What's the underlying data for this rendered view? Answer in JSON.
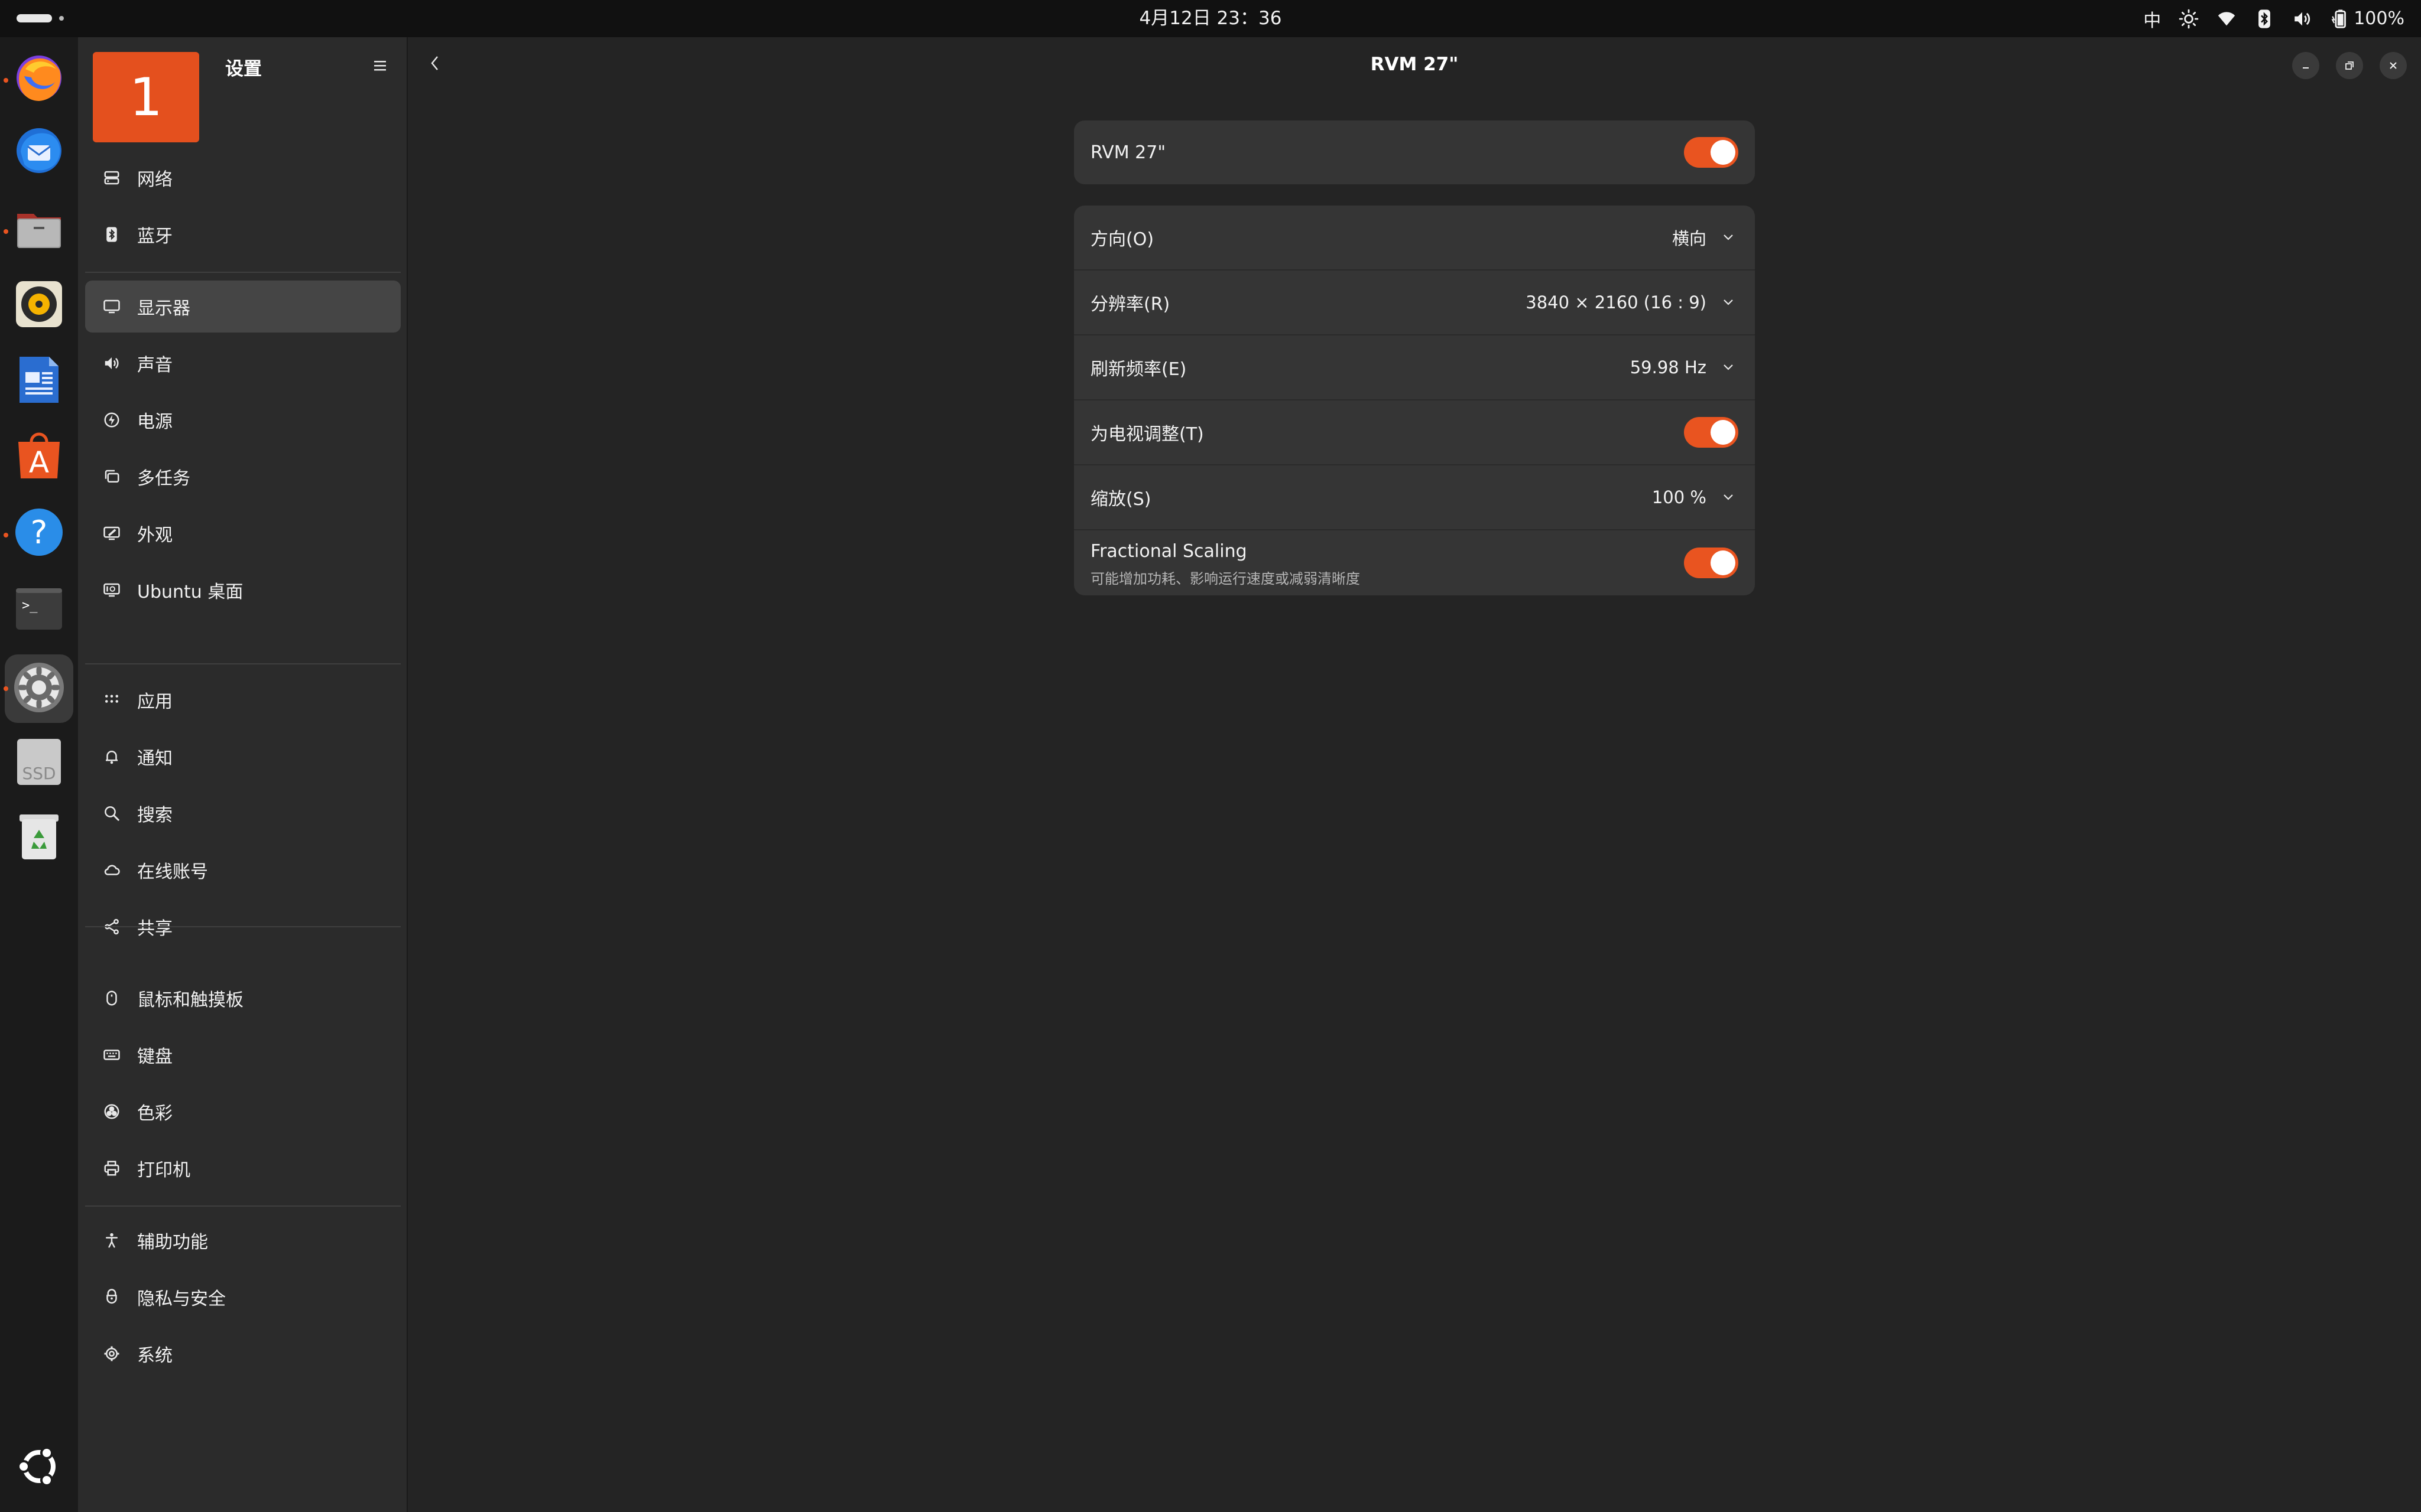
{
  "topbar": {
    "clock": "4月12日 23：36",
    "input_method": "中",
    "battery": "100%"
  },
  "dock": {
    "apps": [
      {
        "name": "Firefox",
        "icon": "firefox-icon",
        "running": true
      },
      {
        "name": "Thunderbird",
        "icon": "thunderbird-icon",
        "running": false
      },
      {
        "name": "Files",
        "icon": "files-icon",
        "running": true
      },
      {
        "name": "Rhythmbox",
        "icon": "rhythmbox-icon",
        "running": false
      },
      {
        "name": "LibreOffice Writer",
        "icon": "writer-icon",
        "running": false
      },
      {
        "name": "App Center",
        "icon": "app-center-icon",
        "running": false
      },
      {
        "name": "Help",
        "icon": "help-icon",
        "running": true
      },
      {
        "name": "Terminal",
        "icon": "terminal-icon",
        "running": false
      },
      {
        "name": "Settings",
        "icon": "settings-gear-icon",
        "running": true
      },
      {
        "name": "SSD",
        "icon": "ssd-drive-icon",
        "running": false,
        "label": "SSD"
      },
      {
        "name": "Trash",
        "icon": "trash-icon",
        "running": false
      },
      {
        "name": "Show Apps",
        "icon": "ubuntu-logo-icon",
        "running": false
      }
    ],
    "terminal_prompt": ">_"
  },
  "sidebar": {
    "logo_number": "1",
    "title": "设置",
    "items": [
      {
        "label": "网络",
        "icon": "network-icon"
      },
      {
        "label": "蓝牙",
        "icon": "bluetooth-icon"
      },
      {
        "label": "显示器",
        "icon": "display-icon",
        "selected": true
      },
      {
        "label": "声音",
        "icon": "sound-icon"
      },
      {
        "label": "电源",
        "icon": "power-icon"
      },
      {
        "label": "多任务",
        "icon": "multitasking-icon"
      },
      {
        "label": "外观",
        "icon": "appearance-icon"
      },
      {
        "label": "Ubuntu 桌面",
        "icon": "ubuntu-desktop-icon"
      },
      {
        "label": "应用",
        "icon": "apps-icon"
      },
      {
        "label": "通知",
        "icon": "notifications-icon"
      },
      {
        "label": "搜索",
        "icon": "search-icon"
      },
      {
        "label": "在线账号",
        "icon": "online-accounts-icon"
      },
      {
        "label": "共享",
        "icon": "sharing-icon"
      },
      {
        "label": "鼠标和触摸板",
        "icon": "mouse-icon"
      },
      {
        "label": "键盘",
        "icon": "keyboard-icon"
      },
      {
        "label": "色彩",
        "icon": "color-icon"
      },
      {
        "label": "打印机",
        "icon": "printer-icon"
      },
      {
        "label": "辅助功能",
        "icon": "accessibility-icon"
      },
      {
        "label": "隐私与安全",
        "icon": "privacy-icon"
      },
      {
        "label": "系统",
        "icon": "system-icon"
      }
    ]
  },
  "main": {
    "title": "RVM 27\"",
    "monitor_card": {
      "label": "RVM 27\"",
      "enabled": true
    },
    "settings": {
      "orientation": {
        "label": "方向(O)",
        "value": "横向"
      },
      "resolution": {
        "label": "分辨率(R)",
        "value": "3840 × 2160 (16 : 9)"
      },
      "refresh_rate": {
        "label": "刷新频率(E)",
        "value": "59.98 Hz"
      },
      "tv_adjust": {
        "label": "为电视调整(T)",
        "enabled": true
      },
      "scale": {
        "label": "缩放(S)",
        "value": "100 %"
      },
      "fractional_scaling": {
        "label": "Fractional Scaling",
        "subtitle": "可能增加功耗、影响运行速度或减弱清晰度",
        "enabled": true
      }
    }
  },
  "colors": {
    "accent": "#e95420",
    "panel": "#111111",
    "sidebar": "#2b2b2b",
    "content": "#242424",
    "card": "#353535"
  }
}
